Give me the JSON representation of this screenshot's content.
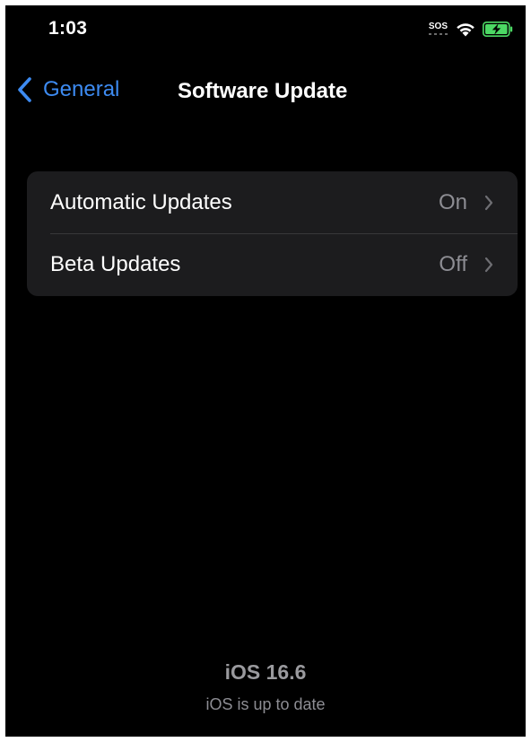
{
  "status_bar": {
    "time": "1:03",
    "sos_label": "SOS",
    "icons": [
      "sos-indicator",
      "wifi-icon",
      "battery-charging-icon"
    ],
    "battery_color": "#4cd964"
  },
  "nav": {
    "back_label": "General",
    "title": "Software Update",
    "accent_color": "#3d8bf2"
  },
  "settings": {
    "rows": [
      {
        "label": "Automatic Updates",
        "value": "On"
      },
      {
        "label": "Beta Updates",
        "value": "Off"
      }
    ]
  },
  "footer": {
    "version": "iOS 16.6",
    "status": "iOS is up to date"
  }
}
